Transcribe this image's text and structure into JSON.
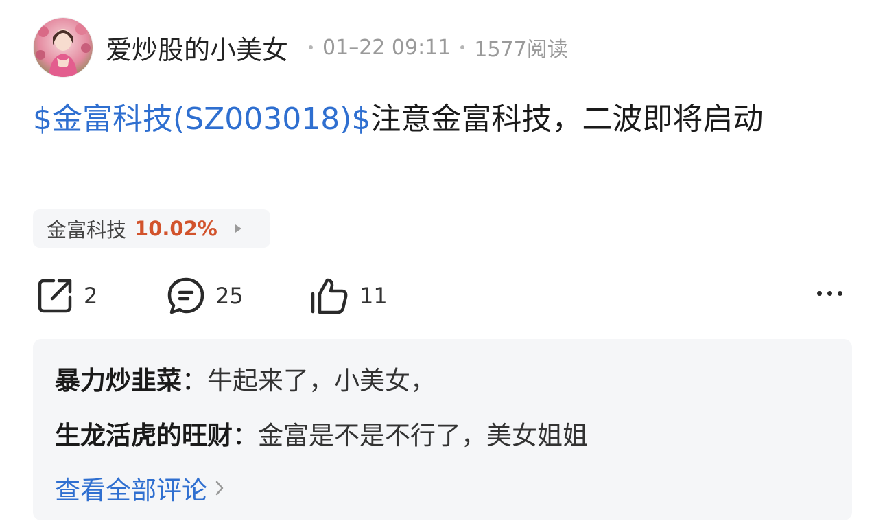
{
  "post": {
    "username": "爱炒股的小美女",
    "date": "01–22 09:11",
    "reads": "1577阅读",
    "stock_link": "$金富科技(SZ003018)$",
    "body": "注意金富科技，二波即将启动"
  },
  "stock_chip": {
    "name": "金富科技",
    "change": "10.02%"
  },
  "actions": {
    "share_count": "2",
    "comment_count": "25",
    "like_count": "11"
  },
  "comments": [
    {
      "author": "暴力炒韭菜",
      "colon": "：",
      "text": "牛起来了，小美女，"
    },
    {
      "author": "生龙活虎的旺财",
      "colon": "：",
      "text": "金富是不是不行了，美女姐姐"
    }
  ],
  "view_all_label": "查看全部评论",
  "colors": {
    "link_blue": "#2f6fd0",
    "rise_red": "#d2532c",
    "panel_bg": "#f5f6f8"
  },
  "icons": [
    "avatar",
    "share-icon",
    "comment-icon",
    "like-icon",
    "more-icon",
    "chevron-right-icon",
    "play-arrow-icon"
  ]
}
